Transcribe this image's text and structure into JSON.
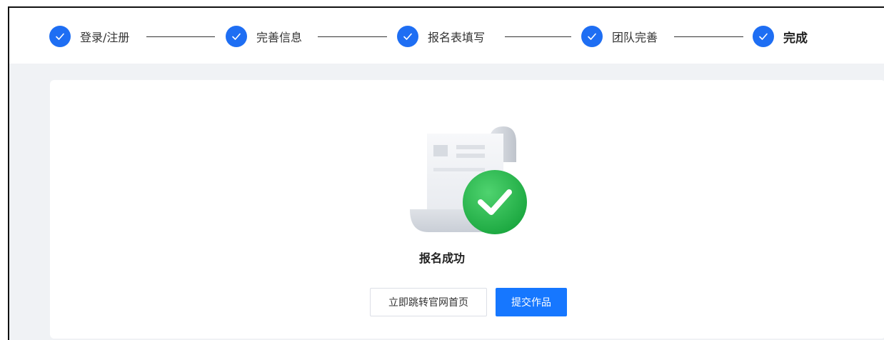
{
  "steps": [
    {
      "label": "登录/注册",
      "icon": "check-icon",
      "status": "done"
    },
    {
      "label": "完善信息",
      "icon": "check-icon",
      "status": "done"
    },
    {
      "label": "报名表填写",
      "icon": "check-icon",
      "status": "done"
    },
    {
      "label": "团队完善",
      "icon": "check-icon",
      "status": "done"
    },
    {
      "label": "完成",
      "icon": "check-icon",
      "status": "current"
    }
  ],
  "result": {
    "title": "报名成功",
    "icon": "success-check-icon"
  },
  "actions": {
    "home_label": "立即跳转官网首页",
    "submit_label": "提交作品"
  },
  "colors": {
    "accent": "#1e6ef3",
    "primary_button": "#1677ff",
    "success": "#22b24c",
    "page_bg": "#f0f2f5"
  }
}
